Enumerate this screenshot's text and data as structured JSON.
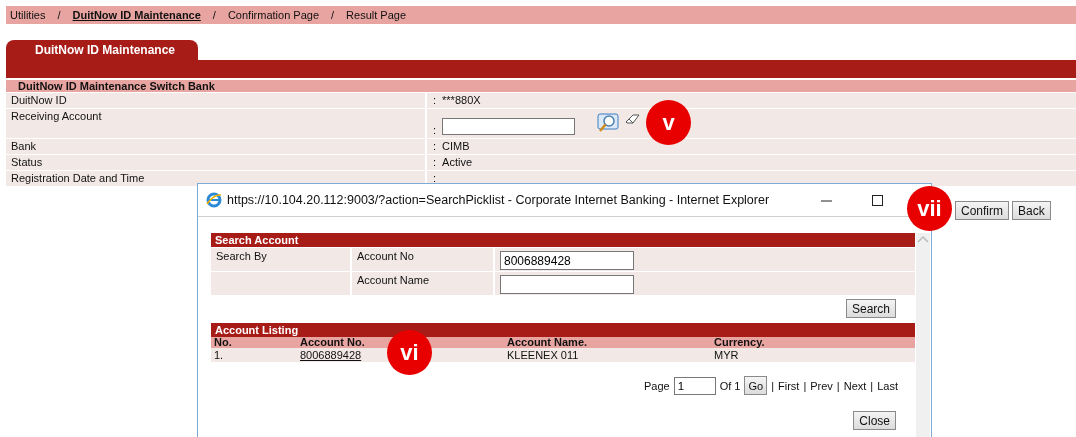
{
  "breadcrumb": {
    "separator": "/",
    "items": [
      {
        "label": "Utilities",
        "selected": false
      },
      {
        "label": "DuitNow ID Maintenance",
        "selected": true
      },
      {
        "label": "Confirmation Page",
        "selected": false
      },
      {
        "label": "Result Page",
        "selected": false
      }
    ]
  },
  "tab": {
    "label": "DuitNow ID Maintenance"
  },
  "section": {
    "title": "DuitNow ID Maintenance Switch Bank",
    "separator": ":",
    "fields": [
      {
        "label": "DuitNow ID",
        "kind": "text",
        "value": "***880X"
      },
      {
        "label": "Receiving Account",
        "kind": "input"
      },
      {
        "label": "Bank",
        "kind": "text",
        "value": "CIMB"
      },
      {
        "label": "Status",
        "kind": "text",
        "value": "Active"
      },
      {
        "label": "Registration Date and Time",
        "kind": "text"
      }
    ]
  },
  "buttons": [
    "Confirm",
    "Back"
  ],
  "popup": {
    "title": "https://10.104.20.112:9003/?action=SearchPicklist - Corporate Internet Banking - Internet Explorer",
    "search": {
      "title": "Search Account",
      "rows": [
        {
          "label": "Search By",
          "field_label": "Account No",
          "value": "8006889428"
        },
        {
          "field_label": "Account Name"
        }
      ],
      "button": "Search"
    },
    "listing": {
      "title": "Account Listing",
      "columns": [
        "No.",
        "Account No.",
        "Account Name.",
        "Currency."
      ],
      "rows": [
        {
          "no": "1.",
          "account_no": "8006889428",
          "account_name": "KLEENEX 011",
          "currency": "MYR"
        }
      ]
    },
    "pager": {
      "label": "Page",
      "value": "1",
      "of": "Of 1",
      "go": "Go",
      "separator": "|",
      "links": [
        "First",
        "Prev",
        "Next",
        "Last"
      ]
    },
    "close": "Close"
  },
  "badges": [
    "v",
    "vi",
    "vii"
  ]
}
